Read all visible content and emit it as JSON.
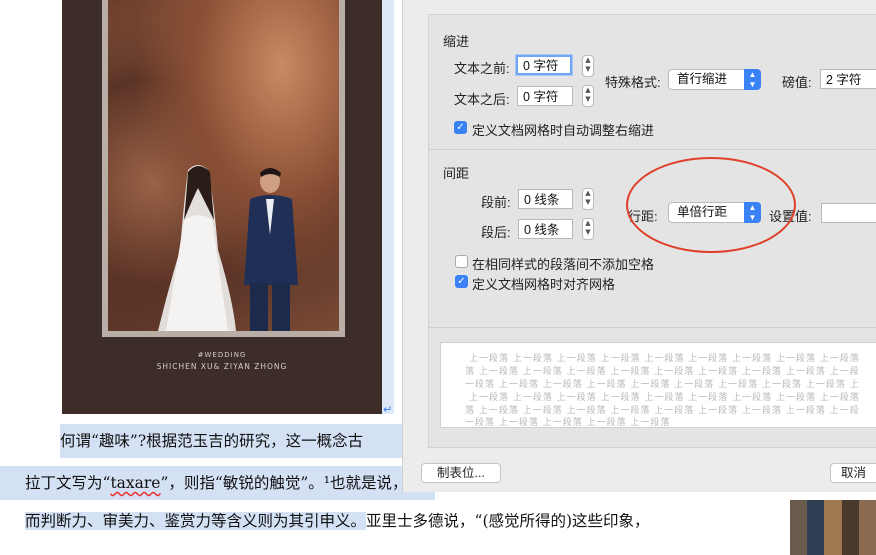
{
  "photo": {
    "caption_line1": "#WEDDING",
    "caption_line2": "SHICHEN XU& ZIYAN ZHONG"
  },
  "document": {
    "line1": "何谓“趣味”?根据范玉吉的研究，这一概念古",
    "line2_pre": "拉丁文写为“",
    "line2_word": "taxare",
    "line2_post": "”，则指“敏锐的触觉”。¹也就是说，",
    "line3_hl": "而判断力、审美力、鉴赏力等含义则为其引申义。",
    "line3_rest": "亚里士多德说，“(感觉所得的)这些印象，",
    "return_mark": "↵"
  },
  "indent": {
    "title": "缩进",
    "before_label": "文本之前:",
    "before_value": "0 字符",
    "after_label": "文本之后:",
    "after_value": "0 字符",
    "special_label": "特殊格式:",
    "special_value": "首行缩进",
    "measure_label": "磅值:",
    "measure_value": "2 字符",
    "auto_adjust_label": "定义文档网格时自动调整右缩进"
  },
  "spacing": {
    "title": "间距",
    "before_label": "段前:",
    "before_value": "0 线条",
    "after_label": "段后:",
    "after_value": "0 线条",
    "line_spacing_label": "行距:",
    "line_spacing_value": "单倍行距",
    "set_value_label": "设置值:",
    "set_value": "",
    "no_space_same_style_label": "在相同样式的段落间不添加空格",
    "snap_to_grid_label": "定义文档网格时对齐网格"
  },
  "preview": {
    "lines": [
      "上一段落  上一段落  上一段落  上一段落  上一段落  上一段落  上一段落  上一段落  上一段落",
      "落  上一段落  上一段落  上一段落  上一段落  上一段落  上一段落  上一段落  上一段落  上一段",
      "一段落  上一段落  上一段落  上一段落  上一段落  上一段落  上一段落  上一段落  上一段落  上",
      "上一段落  上一段落  上一段落  上一段落  上一段落  上一段落  上一段落  上一段落  上一段落",
      "落  上一段落  上一段落  上一段落  上一段落  上一段落  上一段落  上一段落  上一段落  上一段",
      "一段落  上一段落  上一段落  上一段落  上一段落"
    ]
  },
  "buttons": {
    "tabs": "制表位...",
    "cancel": "取消"
  },
  "colors": {
    "accent": "#3b82f6",
    "highlight": "#d4e1f5",
    "annotation_circle": "#e0402a"
  }
}
